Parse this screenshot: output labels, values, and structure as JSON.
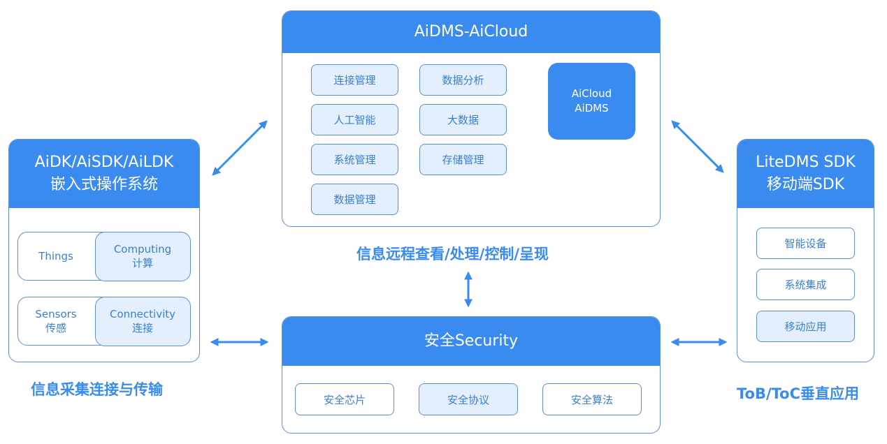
{
  "colors": {
    "primary": "#3a8bf0",
    "border": "#5a8fd1",
    "chip_fill": "#e3effc",
    "text": "#3a7fd0"
  },
  "cloud": {
    "title": "AiDMS-AiCloud",
    "modules": [
      "连接管理",
      "人工智能",
      "系统管理",
      "数据管理",
      "数据分析",
      "大数据",
      "存储管理"
    ],
    "core": [
      "AiCloud",
      "AiDMS"
    ]
  },
  "caption_cloud": "信息远程查看/处理/控制/呈现",
  "embedded": {
    "title_line1": "AiDK/AiSDK/AiLDK",
    "title_line2": "嵌入式操作系统",
    "rows": [
      {
        "left": [
          "Things"
        ],
        "right": [
          "Computing",
          "计算"
        ]
      },
      {
        "left": [
          "Sensors",
          "传感"
        ],
        "right": [
          "Connectivity",
          "连接"
        ]
      }
    ]
  },
  "caption_embedded": "信息采集连接与传输",
  "mobile": {
    "title_line1": "LiteDMS SDK",
    "title_line2": "移动端SDK",
    "items": [
      "智能设备",
      "系统集成",
      "移动应用"
    ]
  },
  "caption_mobile": "ToB/ToC垂直应用",
  "security": {
    "title": "安全Security",
    "items": [
      "安全芯片",
      "安全协议",
      "安全算法"
    ]
  },
  "arrows": [
    "arrow-embedded-cloud",
    "arrow-cloud-mobile",
    "arrow-caption-security",
    "arrow-embedded-security",
    "arrow-security-mobile"
  ]
}
